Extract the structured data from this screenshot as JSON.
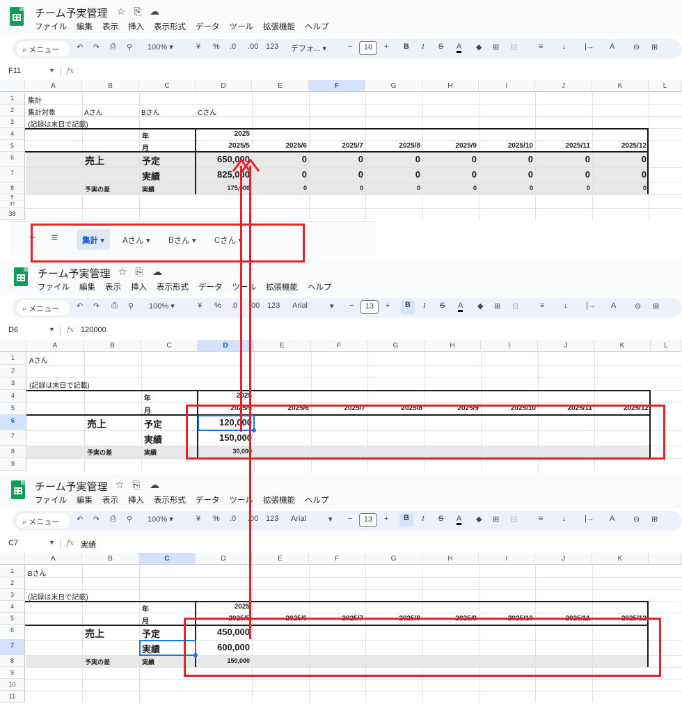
{
  "app": {
    "title": "チーム予実管理",
    "menu": [
      "ファイル",
      "編集",
      "表示",
      "挿入",
      "表示形式",
      "データ",
      "ツール",
      "拡張機能",
      "ヘルプ"
    ],
    "search_label": "メニュー",
    "star_icon": "☆",
    "move_icon": "⎘",
    "cloud_icon": "☁",
    "toolbar": {
      "undo": "↶",
      "redo": "↷",
      "print": "⎙",
      "paint": "⚲",
      "zoom": "100%",
      "currency": "¥",
      "percent": "%",
      "dec_minus": ".0",
      "dec_plus": ".00",
      "num123": "123",
      "minus": "−",
      "plus": "+",
      "bold": "B",
      "italic": "I",
      "strike": "S",
      "text_color": "A",
      "fill": "◆",
      "borders": "⊞",
      "merge": "⊟",
      "align": "≡",
      "valign": "↓",
      "wrap": "|→",
      "rotate": "A",
      "link": "⊖",
      "comment": "⊞"
    }
  },
  "columns": [
    "A",
    "B",
    "C",
    "D",
    "E",
    "F",
    "G",
    "H",
    "I",
    "J",
    "K",
    "L"
  ],
  "months": [
    "2025/5",
    "2025/6",
    "2025/7",
    "2025/8",
    "2025/9",
    "2025/10",
    "2025/11",
    "2025/12"
  ],
  "panel1": {
    "font": "デフォ...",
    "font_size": "10",
    "cell_ref": "F11",
    "formula": "",
    "row_nums": [
      "1",
      "2",
      "3",
      "4",
      "5",
      "6",
      "7",
      "8",
      "9",
      "37",
      "38"
    ],
    "a1": "集計",
    "a2": "集計対象",
    "b2": "Aさん",
    "c2": "Bさん",
    "d2": "Cさん",
    "a3": "(記録は末日で記載)",
    "c4": "年",
    "d4": "2025",
    "c5": "月",
    "b6": "売上",
    "c6": "予定",
    "c7": "実績",
    "b8": "予実の差",
    "c8": "実績",
    "row6": [
      "650,000",
      "0",
      "0",
      "0",
      "0",
      "0",
      "0",
      "0"
    ],
    "row7": [
      "825,000",
      "0",
      "0",
      "0",
      "0",
      "0",
      "0",
      "0"
    ],
    "row8": [
      "175,000",
      "0",
      "0",
      "0",
      "0",
      "0",
      "0",
      "0"
    ],
    "tabs": {
      "add": "+",
      "all": "≡",
      "t1": "集計",
      "t2": "Aさん",
      "t3": "Bさん",
      "t4": "Cさん",
      "caret": "▾"
    }
  },
  "panel2": {
    "font": "Arial",
    "font_size": "13",
    "cell_ref": "D6",
    "formula": "120000",
    "row_nums": [
      "1",
      "2",
      "3",
      "4",
      "5",
      "6",
      "7",
      "8",
      "9"
    ],
    "a1": "Aさん",
    "a3": "(記録は末日で記載)",
    "c4": "年",
    "d4": "2025",
    "c5": "月",
    "b6": "売上",
    "c6": "予定",
    "c7": "実績",
    "b8": "予実の差",
    "c8": "実績",
    "d6": "120,000",
    "d7": "150,000",
    "d8": "30,000"
  },
  "panel3": {
    "font": "Arial",
    "font_size": "13",
    "cell_ref": "C7",
    "formula": "実績",
    "row_nums": [
      "1",
      "2",
      "3",
      "4",
      "5",
      "6",
      "7",
      "8",
      "9",
      "10",
      "11"
    ],
    "a1": "Bさん",
    "a3": "(記録は末日で記載)",
    "c4": "年",
    "d4": "2025",
    "c5": "月",
    "b6": "売上",
    "c6": "予定",
    "c7": "実績",
    "b8": "予実の差",
    "c8": "実績",
    "d6": "450,000",
    "d7": "600,000",
    "d8": "150,000"
  },
  "colors": {
    "annotation_red": "#e8202a",
    "sheets_green": "#0f9d58",
    "selection_blue": "#1a73e8"
  }
}
